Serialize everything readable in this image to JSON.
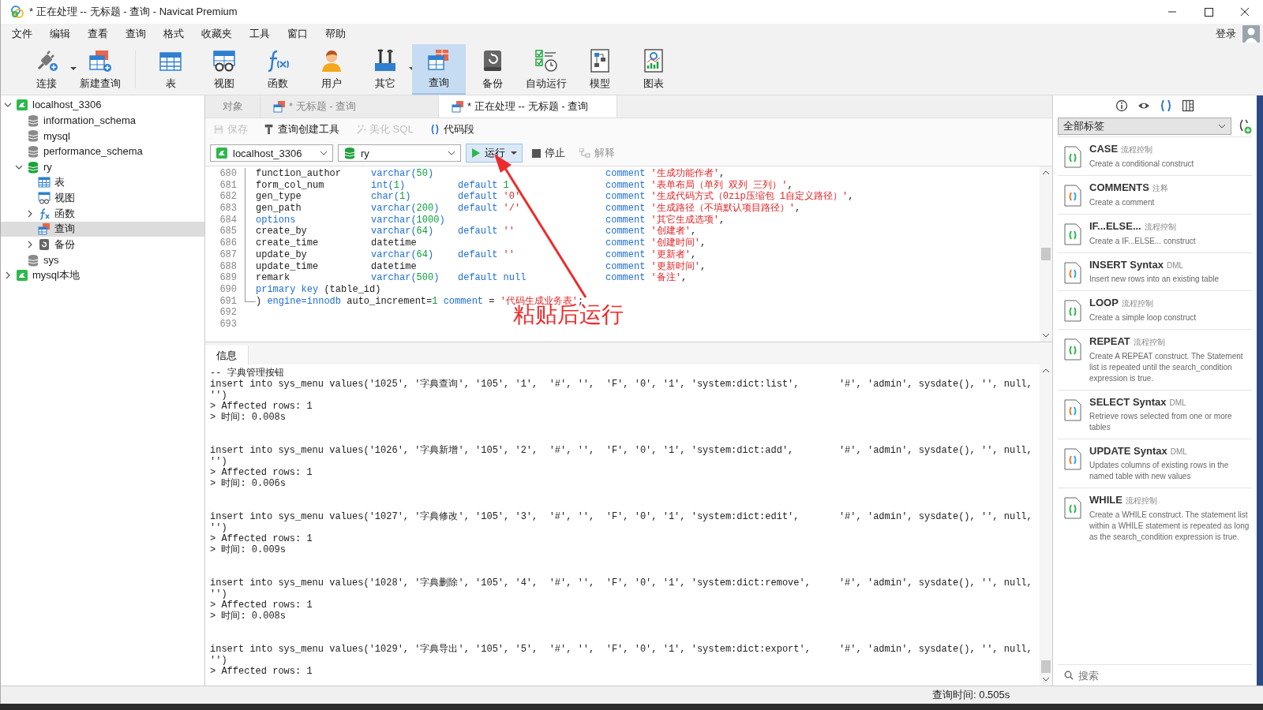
{
  "window": {
    "title": "* 正在处理 -- 无标题 - 查询 - Navicat Premium"
  },
  "menu": [
    "文件",
    "编辑",
    "查看",
    "查询",
    "格式",
    "收藏夹",
    "工具",
    "窗口",
    "帮助"
  ],
  "login": "登录",
  "toolbar": [
    {
      "label": "连接",
      "kind": "connection",
      "dropdown": true,
      "selected": false
    },
    {
      "label": "新建查询",
      "kind": "new-query",
      "dropdown": false,
      "selected": false
    },
    {
      "label": "表",
      "kind": "table",
      "dropdown": false,
      "selected": false
    },
    {
      "label": "视图",
      "kind": "view",
      "dropdown": false,
      "selected": false
    },
    {
      "label": "函数",
      "kind": "function",
      "dropdown": false,
      "selected": false
    },
    {
      "label": "用户",
      "kind": "user",
      "dropdown": false,
      "selected": false
    },
    {
      "label": "其它",
      "kind": "other",
      "dropdown": true,
      "selected": false
    },
    {
      "label": "查询",
      "kind": "query",
      "dropdown": false,
      "selected": true
    },
    {
      "label": "备份",
      "kind": "backup",
      "dropdown": false,
      "selected": false
    },
    {
      "label": "自动运行",
      "kind": "automation",
      "dropdown": false,
      "selected": false
    },
    {
      "label": "模型",
      "kind": "model",
      "dropdown": false,
      "selected": false
    },
    {
      "label": "图表",
      "kind": "chart",
      "dropdown": false,
      "selected": false
    }
  ],
  "tree": [
    {
      "label": "localhost_3306",
      "kind": "connection",
      "expanded": true,
      "selected": false,
      "children": [
        {
          "label": "information_schema",
          "kind": "database",
          "selected": false
        },
        {
          "label": "mysql",
          "kind": "database",
          "selected": false
        },
        {
          "label": "performance_schema",
          "kind": "database",
          "selected": false
        },
        {
          "label": "ry",
          "kind": "open-database",
          "expanded": true,
          "selected": false,
          "children": [
            {
              "label": "表",
              "kind": "table",
              "selected": false
            },
            {
              "label": "视图",
              "kind": "view",
              "selected": false
            },
            {
              "label": "函数",
              "kind": "function",
              "expanded": false,
              "selected": false
            },
            {
              "label": "查询",
              "kind": "query",
              "selected": true
            },
            {
              "label": "备份",
              "kind": "backup",
              "expanded": false,
              "selected": false
            }
          ]
        },
        {
          "label": "sys",
          "kind": "database",
          "selected": false
        }
      ]
    },
    {
      "label": "mysql本地",
      "kind": "connection",
      "expanded": false,
      "selected": false
    }
  ],
  "tabs": [
    {
      "label": "对象",
      "kind": "objects",
      "selected": false
    },
    {
      "label": "* 无标题 - 查询",
      "kind": "query",
      "selected": false
    },
    {
      "label": "* 正在处理 -- 无标题 - 查询",
      "kind": "query",
      "selected": true
    }
  ],
  "query_toolbar": [
    {
      "label": "保存",
      "kind": "save",
      "disabled": true
    },
    {
      "label": "查询创建工具",
      "kind": "builder",
      "disabled": false
    },
    {
      "label": "美化 SQL",
      "kind": "beautify",
      "disabled": true
    },
    {
      "label": "代码段",
      "kind": "snippet",
      "disabled": false
    }
  ],
  "connection_select": {
    "value": "localhost_3306"
  },
  "database_select": {
    "value": "ry"
  },
  "run_button": {
    "label": "运行"
  },
  "stop_button": {
    "label": "停止"
  },
  "explain_button": {
    "label": "解释",
    "disabled": true
  },
  "editor": {
    "lines": [
      {
        "n": "680",
        "kind": "column",
        "name": [
          {
            "text": "function_author",
            "kind": "id"
          }
        ],
        "type": [
          {
            "text": "varchar(",
            "kind": "kw"
          },
          {
            "text": "50",
            "kind": "num"
          },
          {
            "text": ")",
            "kind": "kw"
          }
        ],
        "comment": [
          {
            "text": "comment ",
            "kind": "kw"
          },
          {
            "text": "'生成功能作者'",
            "kind": "str"
          },
          {
            "text": ",",
            "kind": "id"
          }
        ]
      },
      {
        "n": "681",
        "kind": "column",
        "name": [
          {
            "text": "form_col_num",
            "kind": "id"
          }
        ],
        "type": [
          {
            "text": "int(",
            "kind": "kw"
          },
          {
            "text": "1",
            "kind": "num"
          },
          {
            "text": ")",
            "kind": "kw"
          }
        ],
        "default": [
          {
            "text": "default ",
            "kind": "kw"
          },
          {
            "text": "1",
            "kind": "num"
          }
        ],
        "comment": [
          {
            "text": "comment ",
            "kind": "kw"
          },
          {
            "text": "'表单布局（单列 双列 三列）'",
            "kind": "str"
          },
          {
            "text": ",",
            "kind": "id"
          }
        ]
      },
      {
        "n": "682",
        "kind": "column",
        "name": [
          {
            "text": "gen_type",
            "kind": "id"
          }
        ],
        "type": [
          {
            "text": "char(",
            "kind": "kw"
          },
          {
            "text": "1",
            "kind": "num"
          },
          {
            "text": ")",
            "kind": "kw"
          }
        ],
        "default": [
          {
            "text": "default ",
            "kind": "kw"
          },
          {
            "text": "'0'",
            "kind": "str"
          }
        ],
        "comment": [
          {
            "text": "comment ",
            "kind": "kw"
          },
          {
            "text": "'生成代码方式（0zip压缩包 1自定义路径）'",
            "kind": "str"
          },
          {
            "text": ",",
            "kind": "id"
          }
        ]
      },
      {
        "n": "683",
        "kind": "column",
        "name": [
          {
            "text": "gen_path",
            "kind": "id"
          }
        ],
        "type": [
          {
            "text": "varchar(",
            "kind": "kw"
          },
          {
            "text": "200",
            "kind": "num"
          },
          {
            "text": ")",
            "kind": "kw"
          }
        ],
        "default": [
          {
            "text": "default ",
            "kind": "kw"
          },
          {
            "text": "'/'",
            "kind": "str"
          }
        ],
        "comment": [
          {
            "text": "comment ",
            "kind": "kw"
          },
          {
            "text": "'生成路径（不填默认项目路径）'",
            "kind": "str"
          },
          {
            "text": ",",
            "kind": "id"
          }
        ]
      },
      {
        "n": "684",
        "kind": "column",
        "name": [
          {
            "text": "options",
            "kind": "kw"
          }
        ],
        "type": [
          {
            "text": "varchar(",
            "kind": "kw"
          },
          {
            "text": "1000",
            "kind": "num"
          },
          {
            "text": ")",
            "kind": "kw"
          }
        ],
        "comment": [
          {
            "text": "comment ",
            "kind": "kw"
          },
          {
            "text": "'其它生成选项'",
            "kind": "str"
          },
          {
            "text": ",",
            "kind": "id"
          }
        ]
      },
      {
        "n": "685",
        "kind": "column",
        "name": [
          {
            "text": "create_by",
            "kind": "id"
          }
        ],
        "type": [
          {
            "text": "varchar(",
            "kind": "kw"
          },
          {
            "text": "64",
            "kind": "num"
          },
          {
            "text": ")",
            "kind": "kw"
          }
        ],
        "default": [
          {
            "text": "default ",
            "kind": "kw"
          },
          {
            "text": "''",
            "kind": "str"
          }
        ],
        "comment": [
          {
            "text": "comment ",
            "kind": "kw"
          },
          {
            "text": "'创建者'",
            "kind": "str"
          },
          {
            "text": ",",
            "kind": "id"
          }
        ]
      },
      {
        "n": "686",
        "kind": "column",
        "name": [
          {
            "text": "create_time",
            "kind": "id"
          }
        ],
        "type": [
          {
            "text": "datetime",
            "kind": "id"
          }
        ],
        "comment": [
          {
            "text": "comment ",
            "kind": "kw"
          },
          {
            "text": "'创建时间'",
            "kind": "str"
          },
          {
            "text": ",",
            "kind": "id"
          }
        ]
      },
      {
        "n": "687",
        "kind": "column",
        "name": [
          {
            "text": "update_by",
            "kind": "id"
          }
        ],
        "type": [
          {
            "text": "varchar(",
            "kind": "kw"
          },
          {
            "text": "64",
            "kind": "num"
          },
          {
            "text": ")",
            "kind": "kw"
          }
        ],
        "default": [
          {
            "text": "default ",
            "kind": "kw"
          },
          {
            "text": "''",
            "kind": "str"
          }
        ],
        "comment": [
          {
            "text": "comment ",
            "kind": "kw"
          },
          {
            "text": "'更新者'",
            "kind": "str"
          },
          {
            "text": ",",
            "kind": "id"
          }
        ]
      },
      {
        "n": "688",
        "kind": "column",
        "name": [
          {
            "text": "update_time",
            "kind": "id"
          }
        ],
        "type": [
          {
            "text": "datetime",
            "kind": "id"
          }
        ],
        "comment": [
          {
            "text": "comment ",
            "kind": "kw"
          },
          {
            "text": "'更新时间'",
            "kind": "str"
          },
          {
            "text": ",",
            "kind": "id"
          }
        ]
      },
      {
        "n": "689",
        "kind": "column",
        "name": [
          {
            "text": "remark",
            "kind": "id"
          }
        ],
        "type": [
          {
            "text": "varchar(",
            "kind": "kw"
          },
          {
            "text": "500",
            "kind": "num"
          },
          {
            "text": ")",
            "kind": "kw"
          }
        ],
        "default": [
          {
            "text": "default ",
            "kind": "kw"
          },
          {
            "text": "null",
            "kind": "kw"
          }
        ],
        "comment": [
          {
            "text": "comment ",
            "kind": "kw"
          },
          {
            "text": "'备注'",
            "kind": "str"
          },
          {
            "text": ",",
            "kind": "id"
          }
        ]
      },
      {
        "n": "690",
        "kind": "raw",
        "code": [
          {
            "text": "primary key",
            "kind": "kw"
          },
          {
            "text": " (table_id)",
            "kind": "id"
          }
        ]
      },
      {
        "n": "691",
        "kind": "raw",
        "code": [
          {
            "text": ") ",
            "kind": "id"
          },
          {
            "text": "engine=innodb",
            "kind": "kw"
          },
          {
            "text": " auto_increment=",
            "kind": "id"
          },
          {
            "text": "1",
            "kind": "num"
          },
          {
            "text": " comment",
            "kind": "kw"
          },
          {
            "text": " = ",
            "kind": "id"
          },
          {
            "text": "'代码生成业务表'",
            "kind": "str"
          },
          {
            "text": ";",
            "kind": "id"
          }
        ]
      },
      {
        "n": "692",
        "kind": "raw"
      },
      {
        "n": "693",
        "kind": "raw"
      }
    ]
  },
  "annotation": {
    "text": "粘贴后运行"
  },
  "result_tab": {
    "label": "信息"
  },
  "log": [
    [
      "-- 字典管理按钮",
      "insert into sys_menu values('1025', '字典查询', '105', '1',  '#', '',  'F', '0', '1', 'system:dict:list',       '#', 'admin', sysdate(), '', null,",
      "'')",
      "> Affected rows: 1",
      "> 时间: 0.008s"
    ],
    [
      "insert into sys_menu values('1026', '字典新增', '105', '2',  '#', '',  'F', '0', '1', 'system:dict:add',        '#', 'admin', sysdate(), '', null,",
      "'')",
      "> Affected rows: 1",
      "> 时间: 0.006s"
    ],
    [
      "insert into sys_menu values('1027', '字典修改', '105', '3',  '#', '',  'F', '0', '1', 'system:dict:edit',       '#', 'admin', sysdate(), '', null,",
      "'')",
      "> Affected rows: 1",
      "> 时间: 0.009s"
    ],
    [
      "insert into sys_menu values('1028', '字典删除', '105', '4',  '#', '',  'F', '0', '1', 'system:dict:remove',     '#', 'admin', sysdate(), '', null,",
      "'')",
      "> Affected rows: 1",
      "> 时间: 0.008s"
    ],
    [
      "insert into sys_menu values('1029', '字典导出', '105', '5',  '#', '',  'F', '0', '1', 'system:dict:export',     '#', 'admin', sysdate(), '', null,",
      "'')",
      "> Affected rows: 1"
    ]
  ],
  "side_panel": {
    "views": [
      {
        "kind": "info",
        "selected": false
      },
      {
        "kind": "preview",
        "selected": false
      },
      {
        "kind": "snippets",
        "selected": true
      },
      {
        "kind": "layout",
        "selected": false
      }
    ],
    "filter": {
      "value": "全部标签"
    },
    "snippets": [
      {
        "name": "CASE",
        "tag": "流程控制",
        "kind": "control",
        "description": "Create a conditional construct"
      },
      {
        "name": "COMMENTS",
        "tag": "注释",
        "kind": "statement",
        "description": "Create a comment"
      },
      {
        "name": "IF...ELSE...",
        "tag": "流程控制",
        "kind": "control",
        "description": "Create a IF...ELSE... construct"
      },
      {
        "name": "INSERT Syntax",
        "tag": "DML",
        "kind": "statement",
        "description": "Insert new rows into an existing table"
      },
      {
        "name": "LOOP",
        "tag": "流程控制",
        "kind": "control",
        "description": "Create a simple loop construct"
      },
      {
        "name": "REPEAT",
        "tag": "流程控制",
        "kind": "control",
        "description": "Create A REPEAT construct. The Statement list is repeated until the search_condition expression is true."
      },
      {
        "name": "SELECT Syntax",
        "tag": "DML",
        "kind": "statement",
        "description": "Retrieve rows selected from one or more tables"
      },
      {
        "name": "UPDATE Syntax",
        "tag": "DML",
        "kind": "statement",
        "description": "Updates columns of existing rows in the named table with new values"
      },
      {
        "name": "WHILE",
        "tag": "流程控制",
        "kind": "control",
        "description": "Create a WHILE construct. The statement list within a WHILE statement is repeated as long as the search_condition expression is true."
      }
    ],
    "search": {
      "placeholder": "搜索"
    }
  },
  "status_bar": {
    "query_time": "查询时间: 0.505s"
  }
}
